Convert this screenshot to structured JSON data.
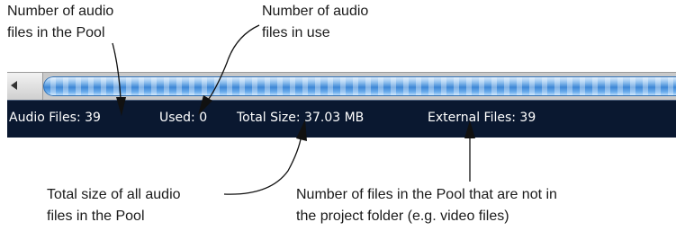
{
  "callouts": {
    "pool_count": {
      "line1": "Number of audio",
      "line2": "files in the Pool"
    },
    "used": {
      "line1": "Number of audio",
      "line2": "files in use"
    },
    "total_size": {
      "line1": "Total size of all audio",
      "line2": "files in the Pool"
    },
    "external": {
      "line1": "Number of files in the Pool that are not in",
      "line2": "the project folder (e.g. video files)"
    }
  },
  "status_bar": {
    "audio_files": "Audio Files: 39",
    "used": "Used: 0",
    "total_size": "Total Size: 37.03 MB",
    "external_files": "External Files: 39"
  },
  "colors": {
    "status_bg": "#0a1830",
    "status_text": "#ffffff",
    "scroll_thumb": "#3d87d6"
  },
  "icons": {
    "scroll_left": "left-arrow-icon"
  }
}
